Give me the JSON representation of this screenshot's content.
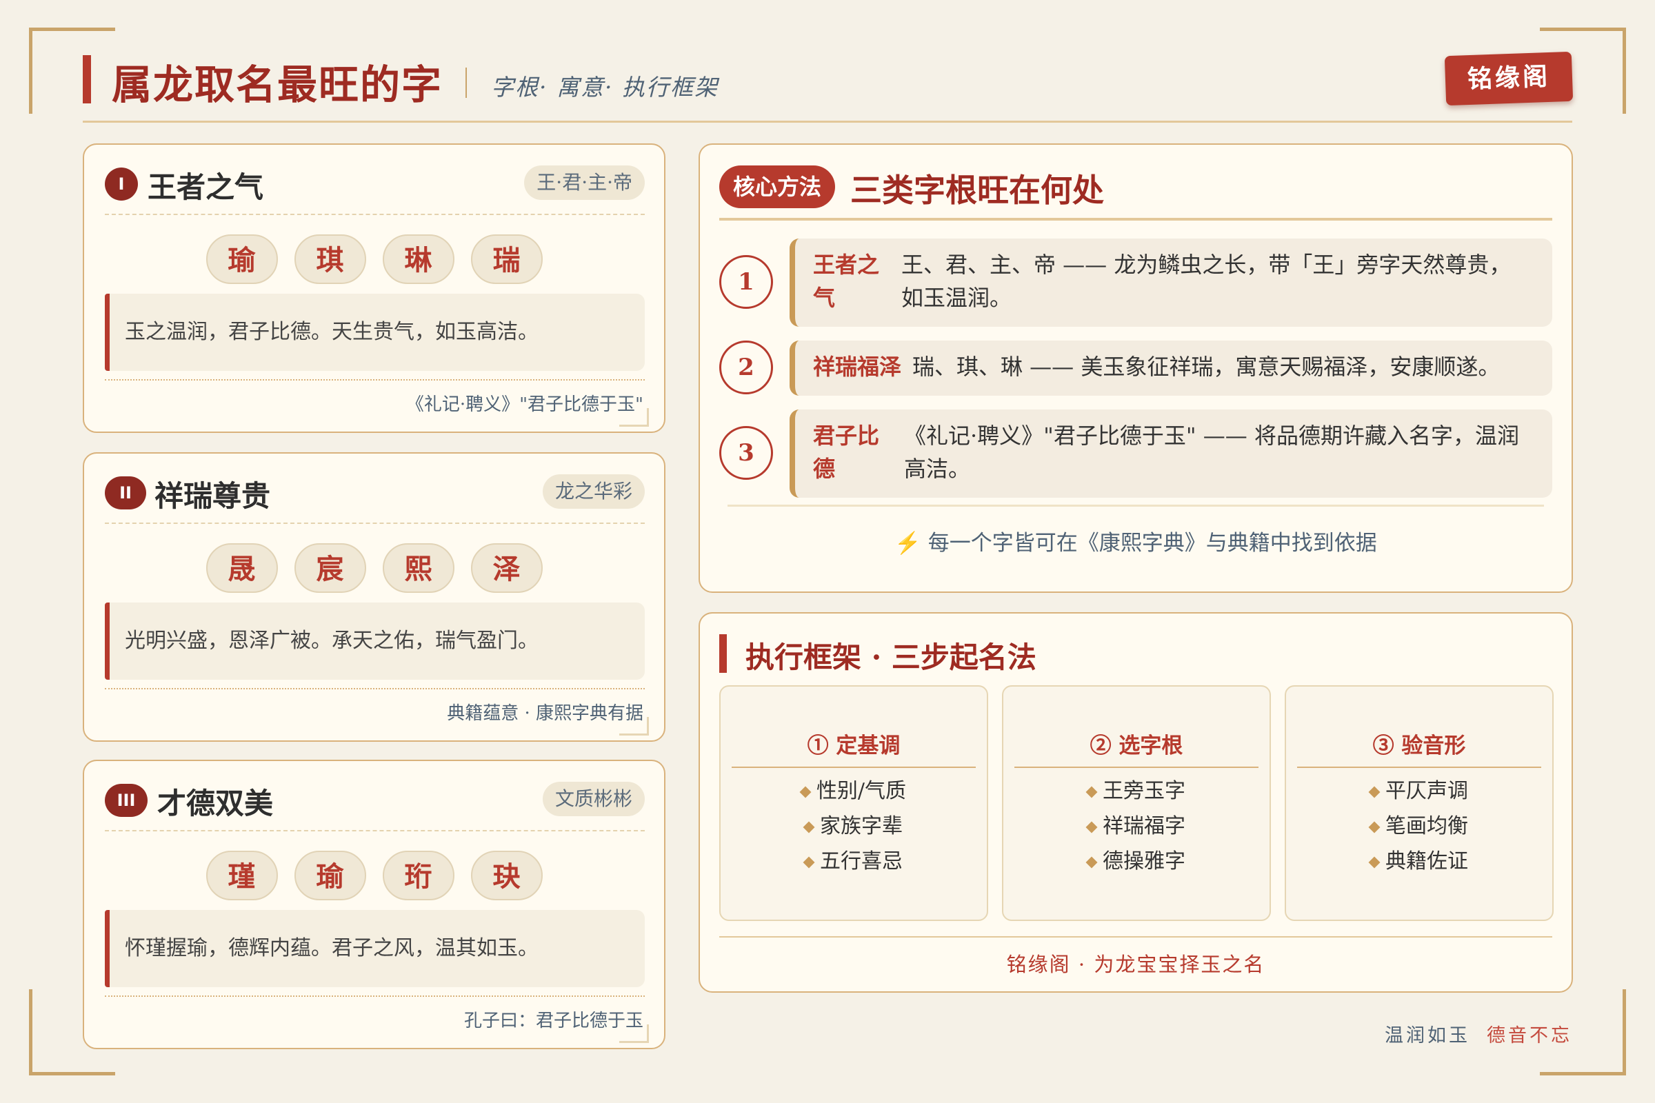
{
  "header": {
    "title": "属龙取名最旺的字",
    "subtitle": "字根· 寓意· 执行框架",
    "stamp": "铭缘阁"
  },
  "cards": [
    {
      "badge": "I",
      "title": "王者之气",
      "tag": "王·君·主·帝",
      "chars": [
        "瑜",
        "琪",
        "琳",
        "瑞"
      ],
      "quote": "玉之温润，君子比德。天生贵气，如玉高洁。",
      "source": "《礼记·聘义》\"君子比德于玉\""
    },
    {
      "badge": "II",
      "title": "祥瑞尊贵",
      "tag": "龙之华彩",
      "chars": [
        "晟",
        "宸",
        "熙",
        "泽"
      ],
      "quote": "光明兴盛，恩泽广被。承天之佑，瑞气盈门。",
      "source": "典籍蕴意 · 康熙字典有据"
    },
    {
      "badge": "III",
      "title": "才德双美",
      "tag": "文质彬彬",
      "chars": [
        "瑾",
        "瑜",
        "珩",
        "玦"
      ],
      "quote": "怀瑾握瑜，德辉内蕴。君子之风，温其如玉。",
      "source": "孔子曰：君子比德于玉"
    }
  ],
  "core": {
    "badge": "核心方法",
    "title": "三类字根旺在何处",
    "rows": [
      {
        "num": "1",
        "key_line1": "王者之",
        "key_line2": "气",
        "text_line1": "王、君、主、帝 —— 龙为鳞虫之长，带「王」旁字天然尊贵，",
        "text_line2": "如玉温润。"
      },
      {
        "num": "2",
        "key": "祥瑞福泽",
        "text": "瑞、琪、琳 —— 美玉象征祥瑞，寓意天赐福泽，安康顺遂。"
      },
      {
        "num": "3",
        "key_line1": "君子比",
        "key_line2": "德",
        "text_line1": "《礼记·聘义》\"君子比德于玉\" —— 将品德期许藏入名字，温润",
        "text_line2": "高洁。"
      }
    ],
    "footer": "⚡ 每一个字皆可在《康熙字典》与典籍中找到依据"
  },
  "exec": {
    "title": "执行框架 · 三步起名法",
    "steps": [
      {
        "title": "① 定基调",
        "items": [
          "性别/气质",
          "家族字辈",
          "五行喜忌"
        ]
      },
      {
        "title": "② 选字根",
        "items": [
          "王旁玉字",
          "祥瑞福字",
          "德操雅字"
        ]
      },
      {
        "title": "③ 验音形",
        "items": [
          "平仄声调",
          "笔画均衡",
          "典籍佐证"
        ]
      }
    ],
    "footer": "铭缘阁 · 为龙宝宝择玉之名"
  },
  "motto": {
    "part1": "温润如玉",
    "part2": "德音不忘"
  },
  "colors": {
    "accent": "#b63a2d",
    "title": "#9e2b22",
    "gold": "#c9a46a",
    "background": "#f5f1e7",
    "muted_blue": "#4f6275"
  }
}
